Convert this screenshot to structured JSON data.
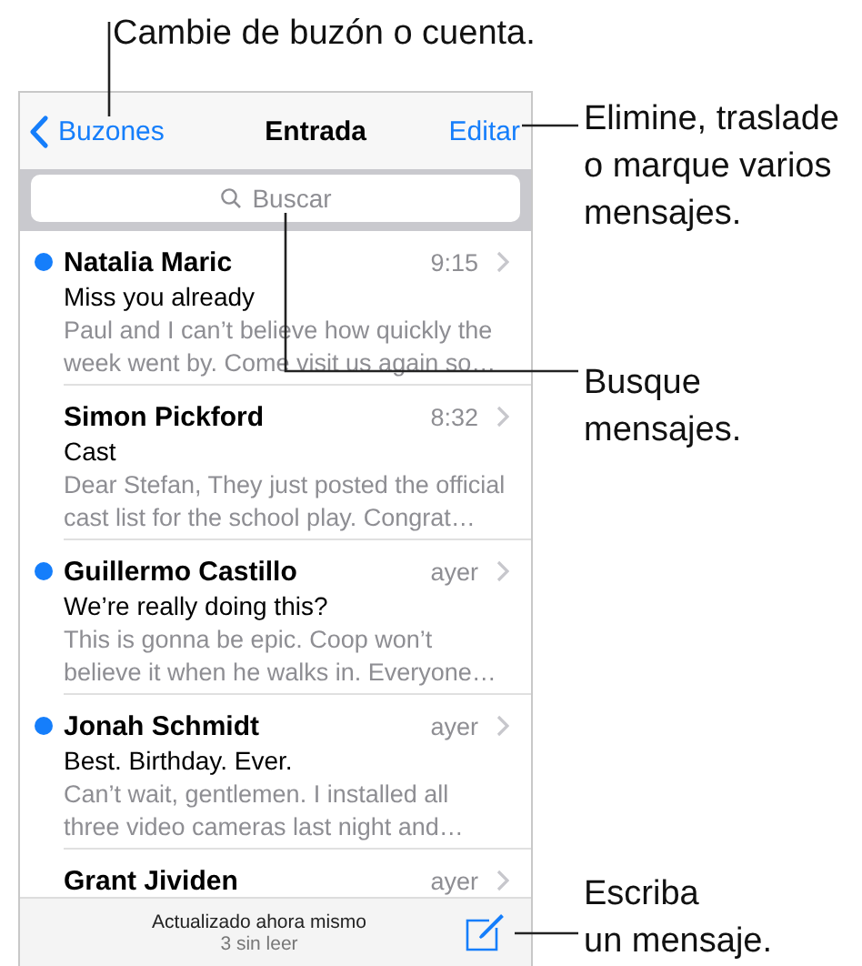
{
  "callouts": [
    {
      "lines": [
        "Cambie de buzón o cuenta."
      ]
    },
    {
      "lines": [
        "Elimine, traslade",
        "o marque varios",
        "mensajes."
      ]
    },
    {
      "lines": [
        "Busque",
        "mensajes."
      ]
    },
    {
      "lines": [
        "Escriba",
        "un mensaje."
      ]
    }
  ],
  "nav": {
    "back": "Buzones",
    "title": "Entrada",
    "action": "Editar"
  },
  "search": {
    "placeholder": "Buscar"
  },
  "messages": [
    {
      "sender": "Natalia Maric",
      "time": "9:15",
      "subject": "Miss you already",
      "preview": "Paul and I can’t believe how quickly the week went by. Come visit us again so…",
      "unread": true
    },
    {
      "sender": "Simon Pickford",
      "time": "8:32",
      "subject": "Cast",
      "preview": "Dear Stefan, They just posted the official cast list for the school play. Congrat…",
      "unread": false
    },
    {
      "sender": "Guillermo Castillo",
      "time": "ayer",
      "subject": "We’re really doing this?",
      "preview": "This is gonna be epic. Coop won’t believe it when he walks in. Everyone…",
      "unread": true
    },
    {
      "sender": "Jonah Schmidt",
      "time": "ayer",
      "subject": "Best. Birthday. Ever.",
      "preview": "Can’t wait, gentlemen. I installed all three video cameras last night and…",
      "unread": true
    },
    {
      "sender": "Grant Jividen",
      "time": "ayer",
      "unread": false
    }
  ],
  "toolbar": {
    "status": "Actualizado ahora mismo",
    "unread_count": "3 sin leer"
  }
}
